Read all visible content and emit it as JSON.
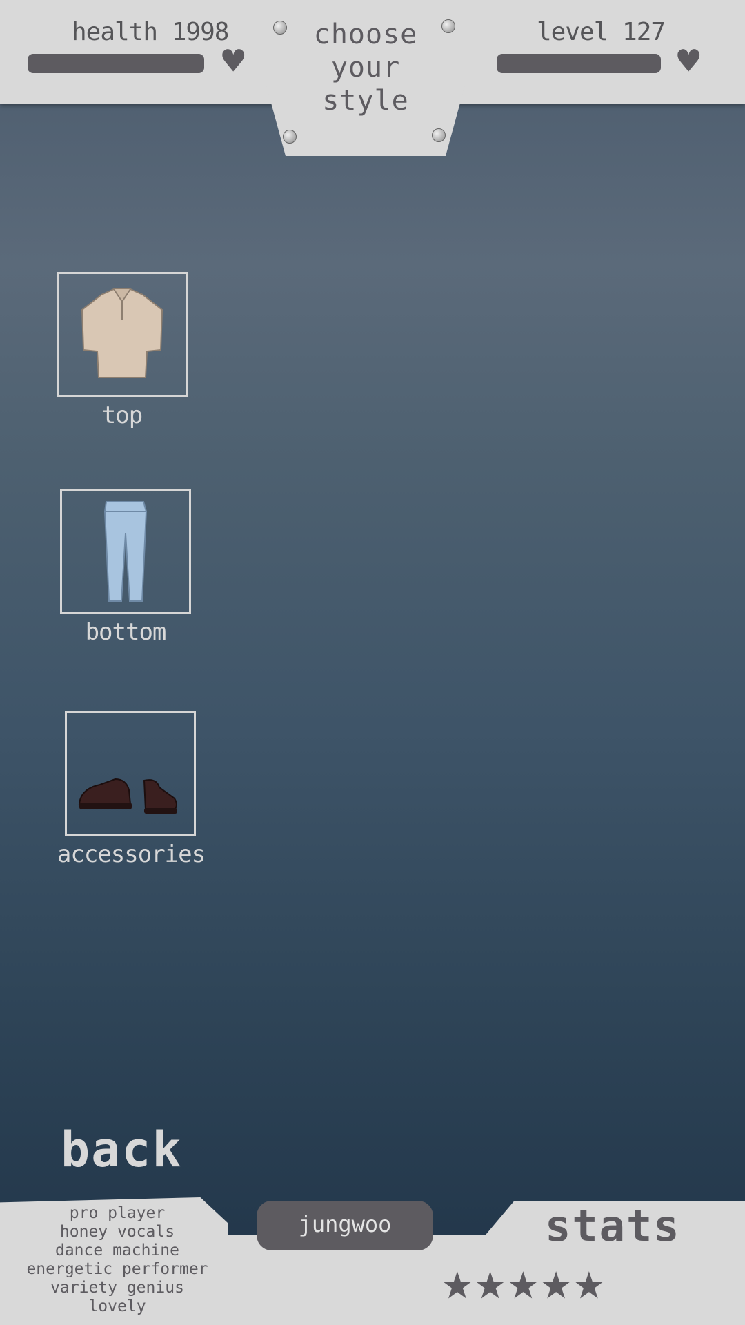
{
  "header": {
    "health_label": "health 1998",
    "level_label": "level 127",
    "title_line1": "choose",
    "title_line2": "your",
    "title_line3": "style"
  },
  "icons": {
    "heart": "heart-icon",
    "rivet": "rivet-icon",
    "star": "star-icon"
  },
  "items": [
    {
      "label": "top",
      "icon": "polo-shirt-icon"
    },
    {
      "label": "bottom",
      "icon": "jeans-icon"
    },
    {
      "label": "accessories",
      "icon": "shoes-icon"
    }
  ],
  "back_label": "back",
  "character": {
    "name": "jungwoo",
    "traits": [
      "pro player",
      "honey vocals",
      "dance machine",
      "energetic performer",
      "variety genius",
      "lovely"
    ]
  },
  "stats": {
    "title": "stats",
    "stars": "★★★★★",
    "rating": 5,
    "max": 5
  },
  "colors": {
    "panel": "#d9d9d9",
    "ink": "#5d5b60",
    "label_light": "#d8d8d8"
  }
}
